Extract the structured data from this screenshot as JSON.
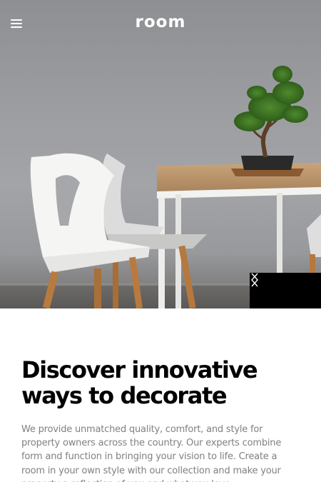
{
  "header": {
    "logo_text": "room",
    "menu_icon": "hamburger-menu-icon"
  },
  "hero": {
    "image_subject": "white chairs, wooden table, bonsai tree",
    "prev_icon": "chevron-left-icon",
    "next_icon": "chevron-right-icon"
  },
  "main": {
    "headline": "Discover innovative ways to decorate",
    "body": "We provide unmatched quality, comfort, and style for property owners across the country. Our experts combine form and function in bringing your vision to life. Create a room in your own style with our collection and make your property a reflection of you and what you love."
  },
  "colors": {
    "hero_wall": "#9c9da1",
    "nav_bg": "#000000",
    "text_primary": "#000000",
    "text_secondary": "#808080"
  }
}
